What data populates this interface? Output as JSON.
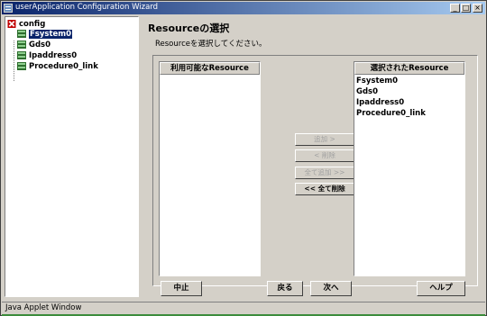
{
  "window": {
    "title": "userApplication Configuration Wizard"
  },
  "titlebar_buttons": {
    "minimize": "_",
    "maximize": "□",
    "close": "×"
  },
  "tree": {
    "root": "config",
    "items": [
      "Fsystem0",
      "Gds0",
      "Ipaddress0",
      "Procedure0_link"
    ],
    "selected": "Fsystem0"
  },
  "page": {
    "title": "Resourceの選択",
    "description": "Resourceを選択してください。"
  },
  "available": {
    "header": "利用可能なResource",
    "items": []
  },
  "selected_list": {
    "header": "選択されたResource",
    "items": [
      "Fsystem0",
      "Gds0",
      "Ipaddress0",
      "Procedure0_link"
    ]
  },
  "mid_buttons": {
    "add": "追加 >",
    "remove": "< 削除",
    "add_all": "全て追加 >>",
    "remove_all": "<< 全て削除"
  },
  "bottom_buttons": {
    "cancel": "中止",
    "back": "戻る",
    "next": "次へ",
    "help": "ヘルプ"
  },
  "status": {
    "text": "Java Applet Window"
  },
  "colors": {
    "titlebar": "#0a246a",
    "face": "#d4d0c8",
    "selection": "#0a246a"
  }
}
